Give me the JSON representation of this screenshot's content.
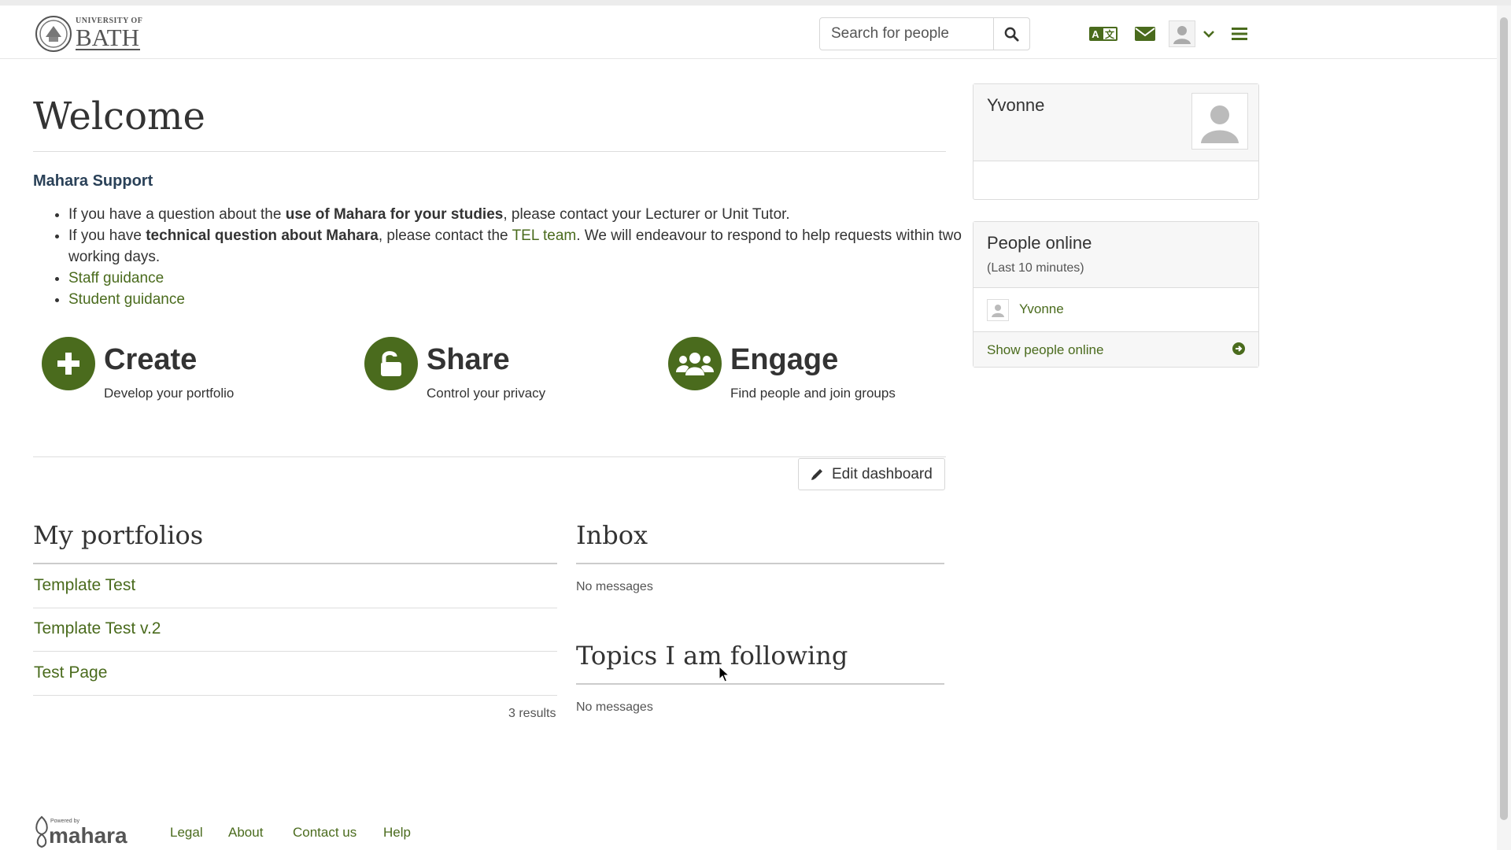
{
  "header": {
    "logo": {
      "small_text": "UNIVERSITY OF",
      "big_text": "BATH",
      "icon": "university-seal-icon"
    },
    "search": {
      "placeholder": "Search for people",
      "value": "",
      "button_icon": "search-icon"
    },
    "icons": [
      "language-icon",
      "mail-icon",
      "user-avatar-icon",
      "chevron-down-icon",
      "menu-icon"
    ]
  },
  "main": {
    "title": "Welcome",
    "support": {
      "title": "Mahara Support",
      "items": [
        {
          "pre": "If you have a question about the ",
          "bold": "use of Mahara for your studies",
          "post": ", please contact your Lecturer or Unit Tutor."
        },
        {
          "pre": "If you have ",
          "bold": "technical question about Mahara",
          "mid": ", please contact the ",
          "link": "TEL team",
          "post": ". We will endeavour to respond to help requests within two working days."
        },
        {
          "link": "Staff guidance"
        },
        {
          "link": "Student guidance"
        }
      ]
    },
    "actions": [
      {
        "title": "Create",
        "subtitle": "Develop your portfolio",
        "icon": "plus-icon"
      },
      {
        "title": "Share",
        "subtitle": "Control your privacy",
        "icon": "unlock-icon"
      },
      {
        "title": "Engage",
        "subtitle": "Find people and join groups",
        "icon": "users-icon"
      }
    ],
    "edit_dashboard": {
      "label": "Edit dashboard",
      "icon": "pencil-icon"
    },
    "portfolios": {
      "title": "My portfolios",
      "items": [
        "Template Test",
        "Template Test v.2",
        "Test Page"
      ],
      "results": "3 results"
    },
    "inbox": {
      "title": "Inbox",
      "empty": "No messages"
    },
    "topics": {
      "title": "Topics I am following",
      "empty": "No messages"
    }
  },
  "sidebar": {
    "profile": {
      "name": "Yvonne",
      "avatar_icon": "user-silhouette-icon"
    },
    "people_online": {
      "title": "People online",
      "subtitle": "(Last 10 minutes)",
      "users": [
        "Yvonne"
      ],
      "show_all": "Show people online",
      "arrow_icon": "arrow-circle-right-icon"
    }
  },
  "footer": {
    "logo_small": "Powered by",
    "logo_text": "mahara",
    "links": [
      "Legal",
      "About",
      "Contact us",
      "Help"
    ]
  },
  "colors": {
    "accent": "#4a6b1d",
    "heading_blue": "#2a4158",
    "text": "#333333"
  }
}
